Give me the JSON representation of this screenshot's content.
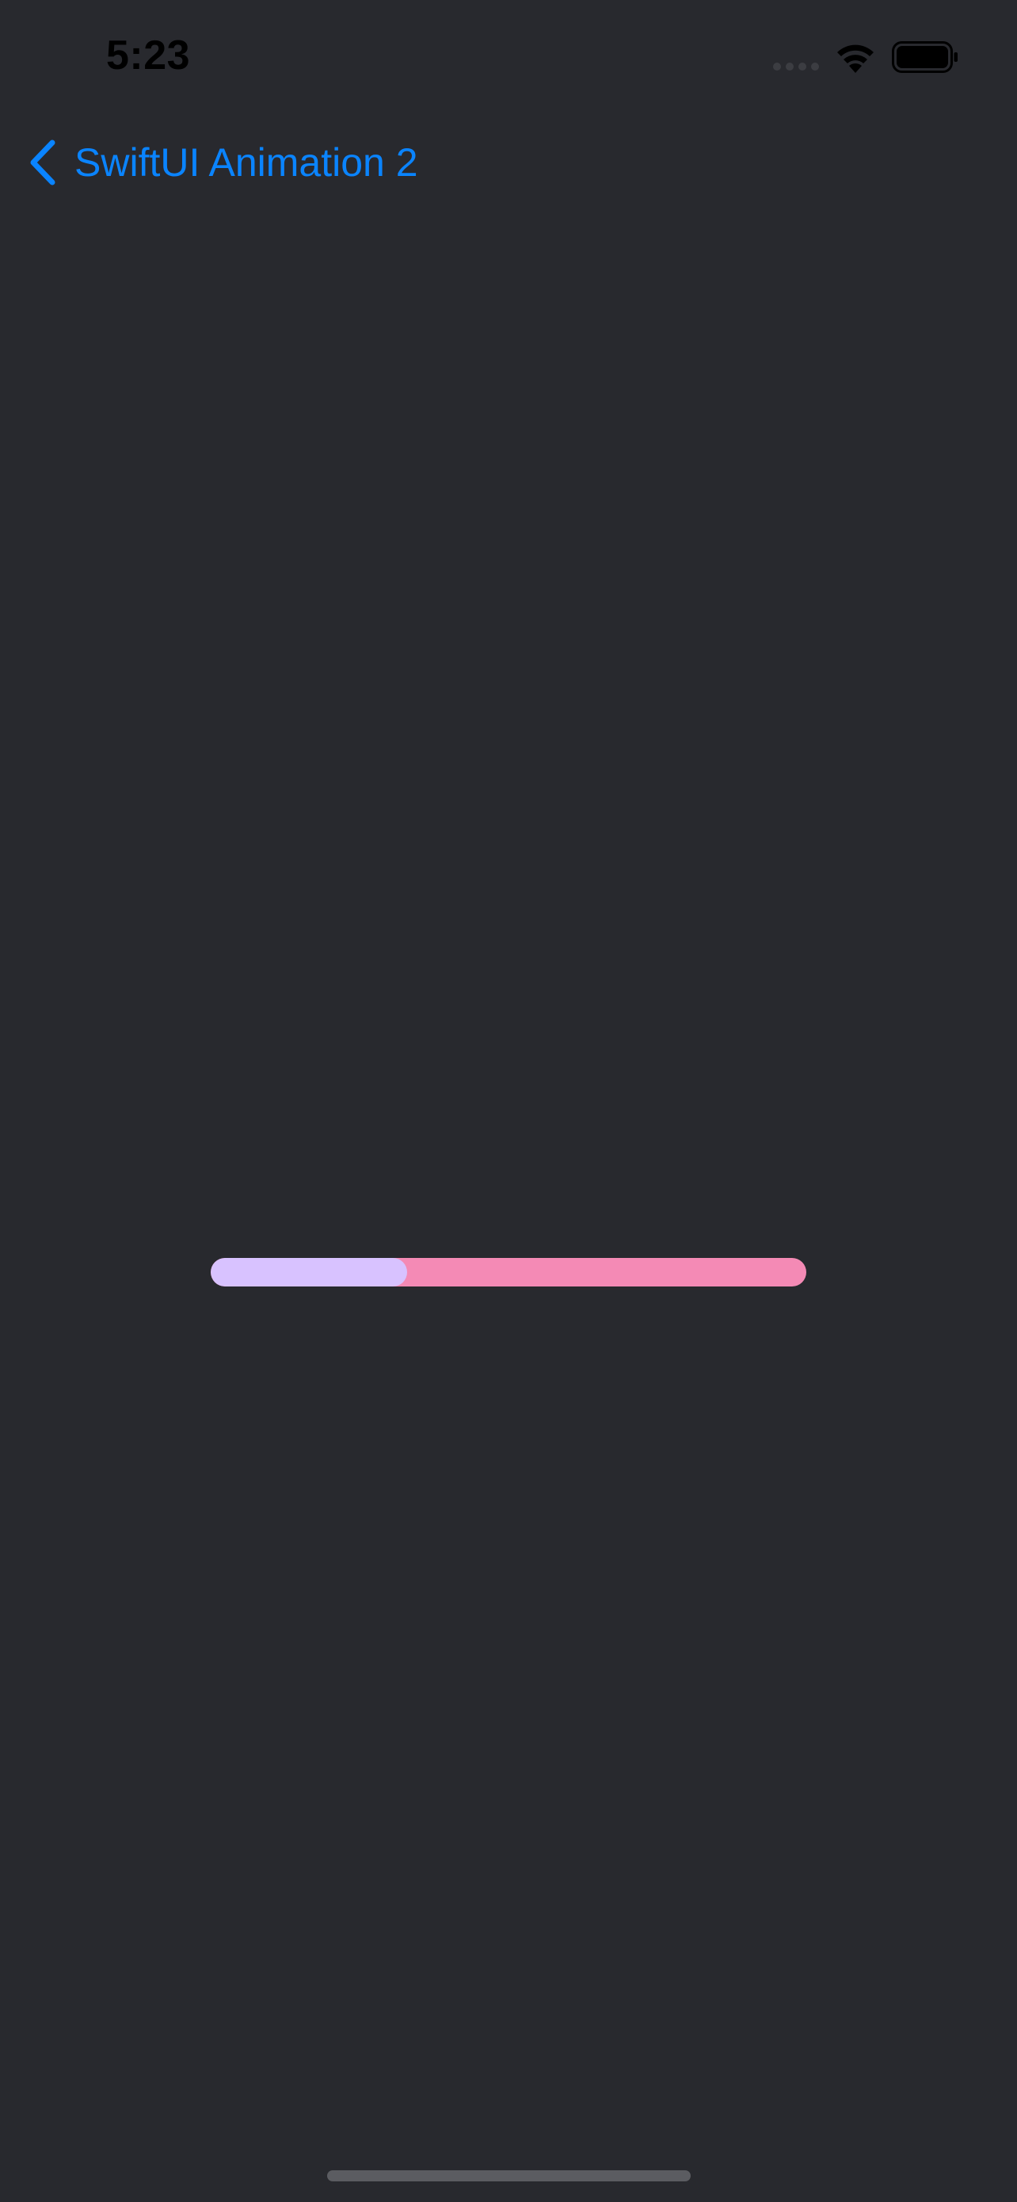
{
  "status_bar": {
    "time": "5:23",
    "icons": [
      "cellular-signal-icon",
      "wifi-icon",
      "battery-icon"
    ]
  },
  "nav_bar": {
    "back_icon": "chevron-left-icon",
    "back_label": "SwiftUI Animation 2"
  },
  "progress": {
    "value": 0.33,
    "fill_color": "#d8c2ff",
    "track_color": "#f48ab5"
  },
  "colors": {
    "background": "#28292e",
    "accent": "#0a84ff"
  }
}
